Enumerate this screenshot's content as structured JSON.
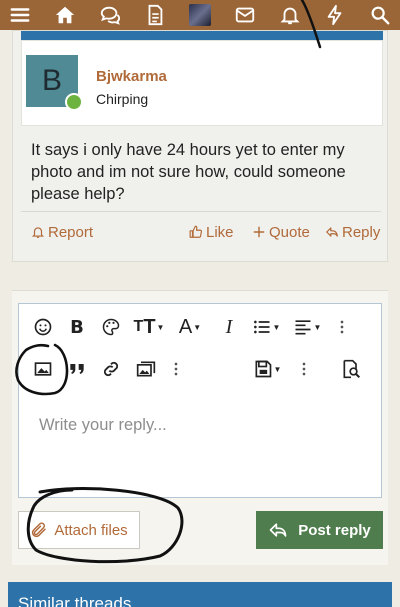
{
  "topbar": {
    "icons": [
      "menu-icon",
      "home-icon",
      "chat-icon",
      "document-icon",
      "user-avatar-thumb",
      "mail-icon",
      "bell-icon",
      "bolt-icon",
      "search-icon"
    ]
  },
  "post": {
    "avatar_letter": "B",
    "username": "Bjwkarma",
    "user_title": "Chirping",
    "body": "It says i only have 24 hours yet to enter my photo and im not sure how, could someone please help?",
    "actions": {
      "report": "Report",
      "like": "Like",
      "quote": "Quote",
      "reply": "Reply"
    }
  },
  "editor": {
    "placeholder": "Write your reply...",
    "toolbar_row1": [
      "emoji-icon",
      "bold-icon",
      "color-palette-icon",
      "text-size-icon",
      "font-icon",
      "italic-icon",
      "list-icon",
      "align-icon",
      "more-options-icon"
    ],
    "toolbar_row2": [
      "insert-image-icon",
      "quote-icon",
      "link-icon",
      "media-icon",
      "more-options-icon",
      "drafts-icon",
      "more-options-icon",
      "preview-icon"
    ],
    "attach_label": "Attach files",
    "post_reply_label": "Post reply"
  },
  "similar_threads": {
    "title": "Similar threads"
  },
  "colors": {
    "topbar": "#9a6537",
    "accent_blue": "#2d72a8",
    "link_brown": "#b16a39",
    "post_button": "#4f7d4d",
    "online_green": "#6db33f"
  }
}
